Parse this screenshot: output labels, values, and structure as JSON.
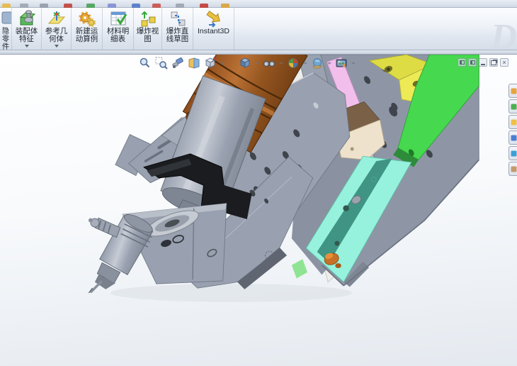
{
  "app": {
    "watermark": "D"
  },
  "menu_strip": {
    "fragments": [
      "#E8B63C",
      "#9AA2AE",
      "#8E98A6",
      "#C03A30",
      "#3F9E4B",
      "#7C88D0",
      "#4A72C4",
      "#C84840",
      "#98A0AC",
      "#C03028",
      "#D8A030"
    ]
  },
  "command_manager": {
    "partial_button": {
      "chars": [
        "隐",
        "零",
        "件"
      ]
    },
    "buttons": [
      {
        "line1": "装配体",
        "line2": "特征",
        "icon": "assembly-features",
        "dropdown": true
      },
      {
        "line1": "参考几",
        "line2": "何体",
        "icon": "reference-geometry",
        "dropdown": true
      },
      {
        "line1": "新建运",
        "line2": "动算例",
        "icon": "new-motion-study",
        "dropdown": false
      },
      {
        "line1": "材料明",
        "line2": "细表",
        "icon": "bill-of-materials",
        "dropdown": false
      },
      {
        "line1": "爆炸视",
        "line2": "图",
        "icon": "exploded-view",
        "dropdown": false
      },
      {
        "line1": "爆炸直",
        "line2": "线草图",
        "icon": "explode-line-sketch",
        "dropdown": false
      },
      {
        "line1": "Instant3D",
        "line2": "",
        "icon": "instant3d",
        "dropdown": false
      }
    ]
  },
  "viewport": {
    "heads_up_toolbar": [
      "zoom-to-fit",
      "zoom-to-area",
      "previous-view",
      "section-view",
      "view-orientation",
      "display-style",
      "hide-show-items",
      "edit-appearance",
      "apply-scene",
      "view-settings"
    ],
    "window_controls": {
      "buttons": [
        "pane-left",
        "pane-right",
        "minimize",
        "restore",
        "close"
      ],
      "close_glyph": "×"
    },
    "task_pane_tabs": [
      {
        "name": "solidworks-resources",
        "color": "#E8A33D"
      },
      {
        "name": "design-library",
        "color": "#4CAF50"
      },
      {
        "name": "file-explorer",
        "color": "#F0C040"
      },
      {
        "name": "view-palette",
        "color": "#4A7FD4"
      },
      {
        "name": "appearances-scenes",
        "color": "#39A0D8"
      },
      {
        "name": "custom-properties",
        "color": "#C89A6B"
      }
    ]
  },
  "model": {
    "description": "3D CAD assembly: motor-driven dispensing spindle mounted on slide plates",
    "colors": {
      "motor": "#8F4E1E",
      "motor_dark": "#4A2808",
      "motor_hi": "#C9803C",
      "spindle": "#9AA2B1",
      "clamp": "#1A1C1F",
      "bracket": "#99A1B0",
      "plate": "#8E96A6",
      "white_strip": "#EDEDEA",
      "pink": "#F2BEEC",
      "tan_top": "#7A6047",
      "tan_front": "#EFE2CC",
      "yellow": "#DDDC44",
      "yellow_front": "#EDEA55",
      "green": "#46D84E",
      "green_dark": "#2E8B3A",
      "green_light": "#8FE493",
      "teal": "#3F9484",
      "mint": "#96F2DC",
      "copper": "#C77028",
      "silver": "#C5CAD3",
      "hole": "#40444C"
    }
  }
}
